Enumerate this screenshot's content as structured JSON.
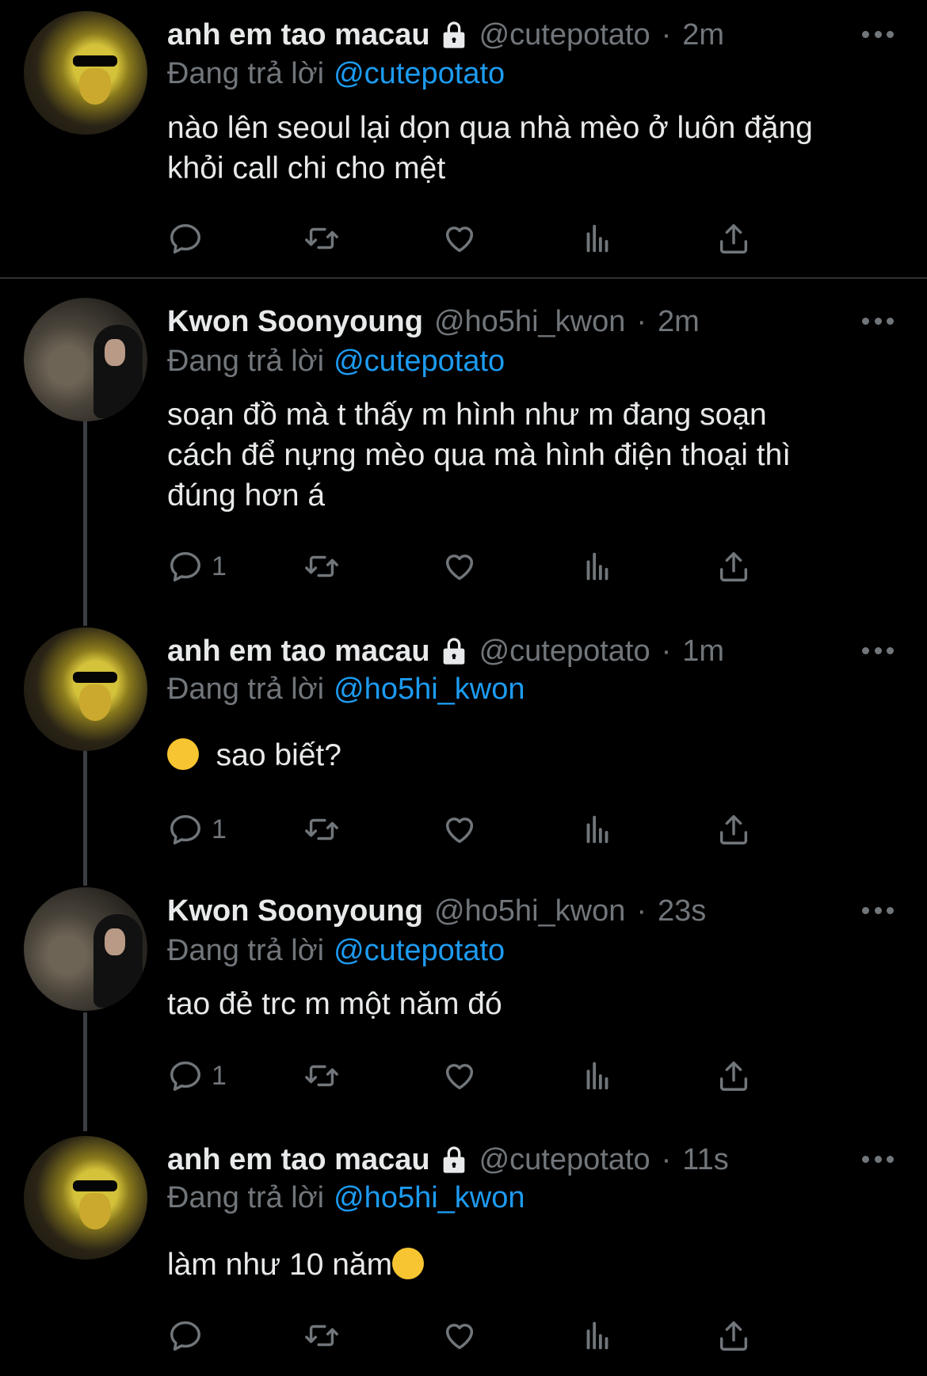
{
  "colors": {
    "background": "#000000",
    "text": "#e7e9ea",
    "muted": "#71767b",
    "mention": "#1d9bf0"
  },
  "tweets": [
    {
      "name": "anh em tao macau",
      "locked": true,
      "handle": "@cutepotato",
      "time": "2m",
      "reply_label": "Đang trả lời",
      "reply_to": "@cutepotato",
      "lines": [
        "nào lên seoul lại dọn qua nhà mèo ở luôn đặng",
        "khỏi call chi cho mệt"
      ],
      "reply_count": ""
    },
    {
      "name": "Kwon Soonyoung",
      "locked": false,
      "handle": "@ho5hi_kwon",
      "time": "2m",
      "reply_label": "Đang trả lời",
      "reply_to": "@cutepotato",
      "lines": [
        "soạn đồ mà t thấy m hình như m đang soạn",
        "cách để nựng mèo qua mà hình điện thoại thì",
        "đúng hơn á"
      ],
      "reply_count": "1"
    },
    {
      "name": "anh em tao macau",
      "locked": true,
      "handle": "@cutepotato",
      "time": "1m",
      "reply_label": "Đang trả lời",
      "reply_to": "@ho5hi_kwon",
      "lines": [
        "sao biết?"
      ],
      "leading_emoji": "smiling-face-emoji",
      "reply_count": "1"
    },
    {
      "name": "Kwon Soonyoung",
      "locked": false,
      "handle": "@ho5hi_kwon",
      "time": "23s",
      "reply_label": "Đang trả lời",
      "reply_to": "@cutepotato",
      "lines": [
        "tao đẻ trc m một năm đó"
      ],
      "reply_count": "1"
    },
    {
      "name": "anh em tao macau",
      "locked": true,
      "handle": "@cutepotato",
      "time": "11s",
      "reply_label": "Đang trả lời",
      "reply_to": "@ho5hi_kwon",
      "lines": [
        "làm như 10 năm"
      ],
      "trailing_emoji": "eye-roll-emoji",
      "reply_count": ""
    }
  ],
  "icons": [
    "reply-icon",
    "retweet-icon",
    "like-icon",
    "analytics-icon",
    "share-icon",
    "more-icon",
    "lock-icon"
  ]
}
